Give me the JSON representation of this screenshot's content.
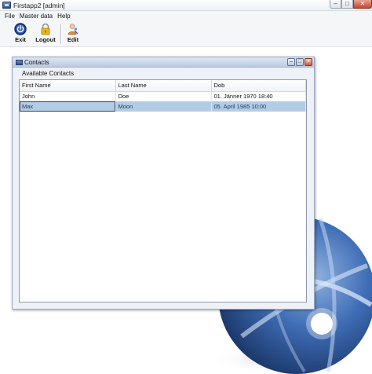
{
  "window": {
    "title": "Firstapp2 [admin]",
    "controls": {
      "minimize": "–",
      "maximize": "□",
      "close": "✕"
    }
  },
  "menu": [
    "File",
    "Master data",
    "Help"
  ],
  "toolbar": {
    "exit_label": "Exit",
    "logout_label": "Logout",
    "edit_label": "Edit"
  },
  "icons": {
    "app": "window-icon",
    "exit": "power-icon",
    "logout": "padlock-icon",
    "edit": "user-edit-icon",
    "decoration": "globe-icon"
  },
  "contacts_window": {
    "title": "Contacts",
    "controls": {
      "minimize": "–",
      "maximize": "□",
      "close": "×"
    },
    "group_label": "Available Contacts",
    "columns": [
      "First Name",
      "Last Name",
      "Dob"
    ],
    "rows": [
      {
        "first": "John",
        "last": "Doe",
        "dob": "01. Jänner 1970 18:40"
      },
      {
        "first": "Max",
        "last": "Moon",
        "dob": "05. April 1985 10:00"
      }
    ],
    "selected_row": 1
  },
  "colors": {
    "selection": "#b4cbe4",
    "globe_dark": "#1f3f7a",
    "globe_light": "#6f95cf",
    "close_button": "#c8462a"
  }
}
